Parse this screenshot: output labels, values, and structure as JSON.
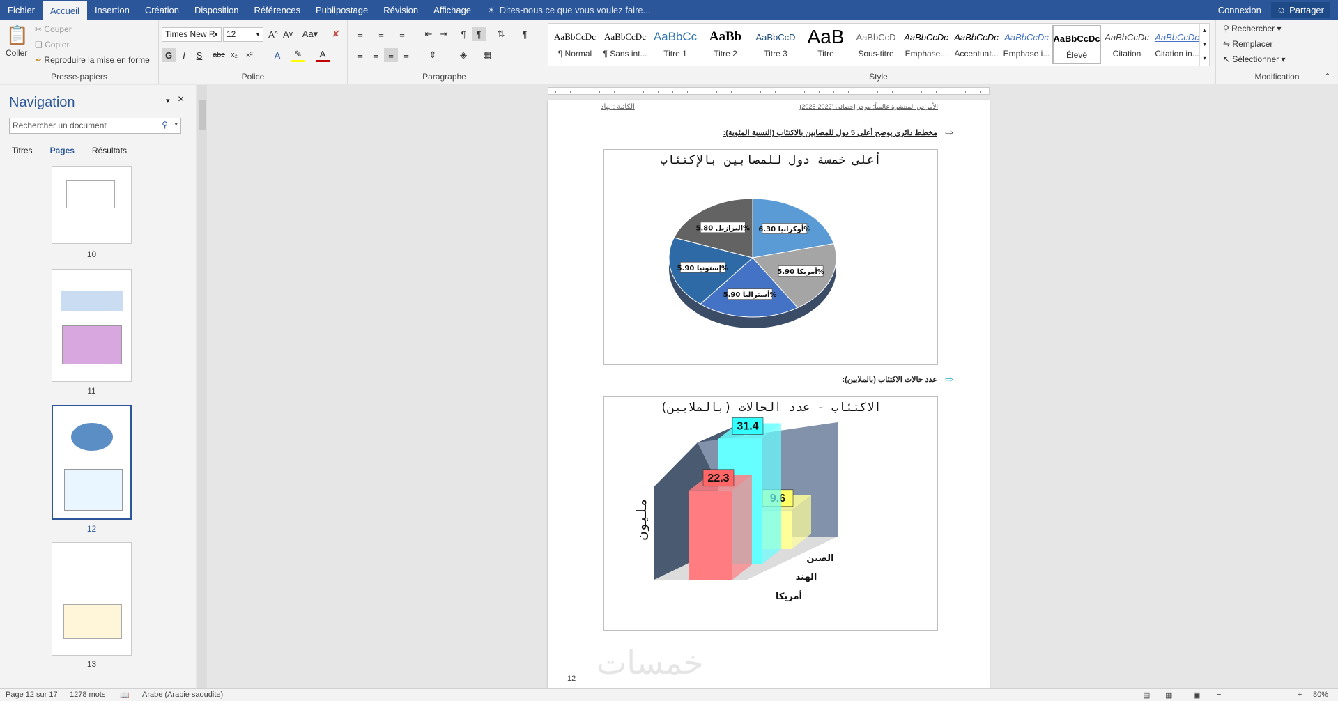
{
  "ribbon_tabs": [
    "Fichier",
    "Accueil",
    "Insertion",
    "Création",
    "Disposition",
    "Références",
    "Publipostage",
    "Révision",
    "Affichage"
  ],
  "tell_me": "Dites-nous ce que vous voulez faire...",
  "account": {
    "signin": "Connexion",
    "share": "Partager"
  },
  "clipboard": {
    "paste": "Coller",
    "cut": "Couper",
    "copy": "Copier",
    "format_painter": "Reproduire la mise en forme",
    "label": "Presse-papiers"
  },
  "font": {
    "name": "Times New R",
    "size": "12",
    "label": "Police",
    "bold": "G",
    "italic": "I",
    "underline": "S"
  },
  "paragraph": {
    "label": "Paragraphe"
  },
  "styles": {
    "label": "Style",
    "items": [
      {
        "preview": "AaBbCcDc",
        "name": "¶ Normal"
      },
      {
        "preview": "AaBbCcDc",
        "name": "¶ Sans int..."
      },
      {
        "preview": "AaBbCc",
        "name": "Titre 1"
      },
      {
        "preview": "AaBb",
        "name": "Titre 2"
      },
      {
        "preview": "AaBbCcD",
        "name": "Titre 3"
      },
      {
        "preview": "AaB",
        "name": "Titre"
      },
      {
        "preview": "AaBbCcD",
        "name": "Sous-titre"
      },
      {
        "preview": "AaBbCcDc",
        "name": "Emphase..."
      },
      {
        "preview": "AaBbCcDc",
        "name": "Accentuat..."
      },
      {
        "preview": "AaBbCcDc",
        "name": "Emphase i..."
      },
      {
        "preview": "AaBbCcDc",
        "name": "Élevé"
      },
      {
        "preview": "AaBbCcDc",
        "name": "Citation"
      },
      {
        "preview": "AaBbCcDc",
        "name": "Citation in..."
      }
    ]
  },
  "editing": {
    "find": "Rechercher",
    "replace": "Remplacer",
    "select": "Sélectionner",
    "label": "Modification"
  },
  "navigation": {
    "title": "Navigation",
    "search_placeholder": "Rechercher un document",
    "tabs": [
      "Titres",
      "Pages",
      "Résultats"
    ],
    "page_numbers": [
      "10",
      "11",
      "12",
      "13"
    ]
  },
  "page": {
    "header_left": "الكاتبة : نهاد",
    "header_right": "الأمراض المنتشرة عالمياً: موجز إحصائي (2022-2025)",
    "caption1": "مخطط دائري يوضح أعلى 5 دول للمصابين بالاكتئاب (النسبة المئوية):",
    "caption2": "عدد حالات الاكتئاب (بالملايين):",
    "number": "12",
    "watermark": "خمسات"
  },
  "chart_data": [
    {
      "type": "pie",
      "title": "أعلى خمسة دول للمصابين بالإكتئاب",
      "slices": [
        {
          "label": "أوكرانيا",
          "value": 6.3,
          "text": "أوكرانيا 6.30%",
          "color": "#5b9bd5"
        },
        {
          "label": "أمريكا",
          "value": 5.9,
          "text": "أمريكا 5.90%",
          "color": "#a5a5a5"
        },
        {
          "label": "أستراليا",
          "value": 5.9,
          "text": "أستراليا 5.90%",
          "color": "#4472c4"
        },
        {
          "label": "إستونيا",
          "value": 5.9,
          "text": "إستونيا 5.90%",
          "color": "#2e6aa6"
        },
        {
          "label": "البرازيل",
          "value": 5.8,
          "text": "البرازيل 5.80%",
          "color": "#636363"
        }
      ]
    },
    {
      "type": "bar",
      "title": "الاكتئاب - عدد الحالات (بالملايين)",
      "ylabel": "مليون",
      "categories": [
        "الصين",
        "الهند",
        "أمريكا"
      ],
      "values": [
        22.3,
        31.4,
        9.6
      ],
      "colors": [
        "#ff7c80",
        "#66ffff",
        "#ffff99"
      ],
      "label_colors": [
        "#ff6666",
        "#33ffff",
        "#ffff66"
      ],
      "ylim": [
        0,
        40
      ]
    }
  ],
  "status": {
    "page": "Page 12 sur 17",
    "words": "1278 mots",
    "language": "Arabe (Arabie saoudite)",
    "zoom": "80%"
  }
}
